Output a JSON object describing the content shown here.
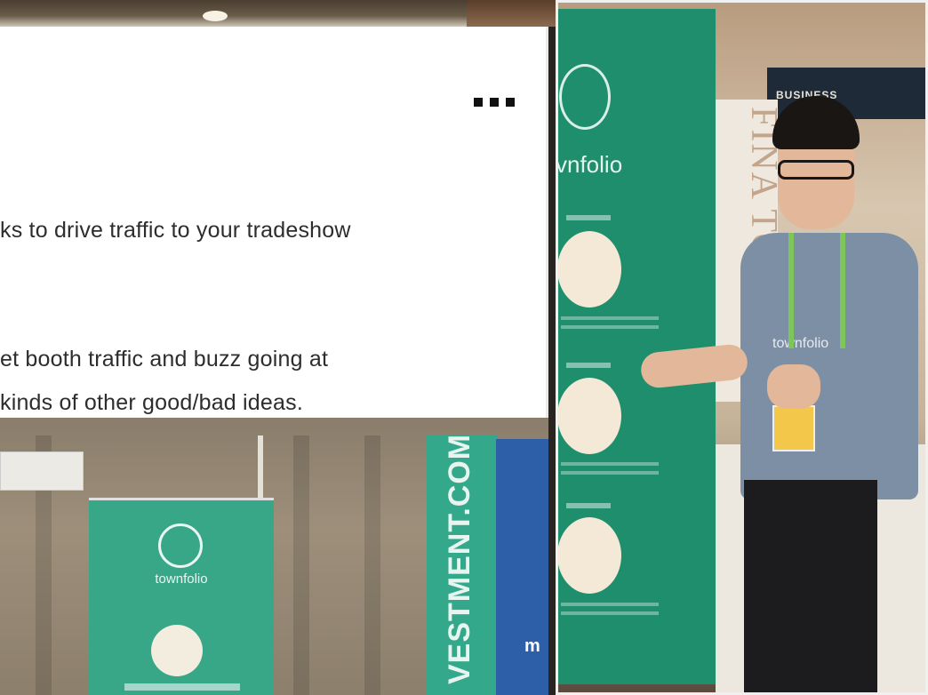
{
  "post": {
    "menu_icon": "more-horizontal-icon",
    "lines": [
      "ks to drive traffic to your tradeshow",
      "et booth traffic and buzz going at",
      "kinds of other good/bad ideas."
    ]
  },
  "photo_left": {
    "banner_brand": "townfolio",
    "side_banner_text": "VESTMENT.COM",
    "blue_banner_text": "m"
  },
  "photo_right": {
    "banner_brand": "vnfolio",
    "sign_text": "BUSINESS",
    "final_text": "FINA TOGA",
    "shirt_text": "townfolio"
  }
}
